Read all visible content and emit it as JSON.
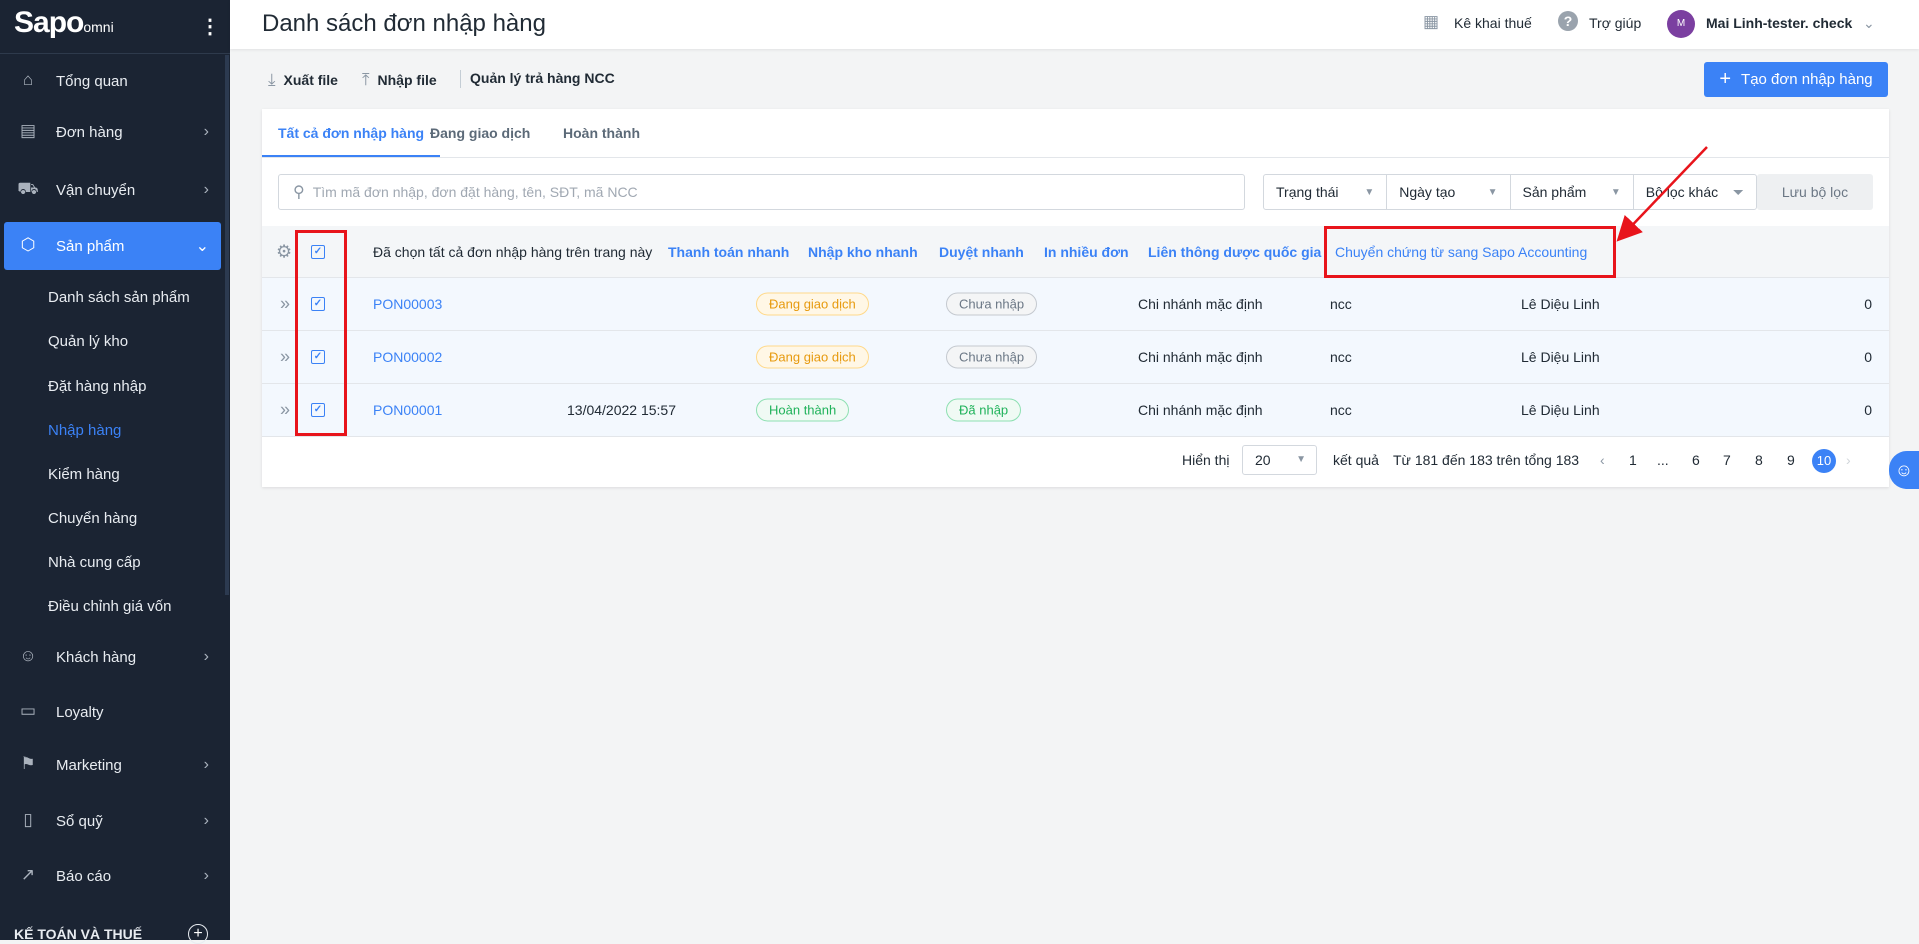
{
  "sidebar": {
    "logo": "Sapo",
    "logo_suffix": "omni",
    "items": [
      {
        "label": "Tổng quan",
        "icon": "home-icon"
      },
      {
        "label": "Đơn hàng",
        "icon": "clipboard-icon"
      },
      {
        "label": "Vận chuyển",
        "icon": "truck-icon"
      },
      {
        "label": "Sản phẩm",
        "icon": "box-icon"
      },
      {
        "label": "Khách hàng",
        "icon": "user-icon"
      },
      {
        "label": "Loyalty",
        "icon": "card-icon"
      },
      {
        "label": "Marketing",
        "icon": "flag-icon"
      },
      {
        "label": "Sổ quỹ",
        "icon": "cashbook-icon"
      },
      {
        "label": "Báo cáo",
        "icon": "chart-icon"
      }
    ],
    "sub_items": [
      "Danh sách sản phẩm",
      "Quản lý kho",
      "Đặt hàng nhập",
      "Nhập hàng",
      "Kiểm hàng",
      "Chuyển hàng",
      "Nhà cung cấp",
      "Điều chỉnh giá vốn"
    ],
    "section": "KẾ TOÁN VÀ THUẾ"
  },
  "header": {
    "title": "Danh sách đơn nhập hàng",
    "tax": "Kê khai thuế",
    "help": "Trợ giúp",
    "avatar": "M",
    "user": "Mai Linh-tester. check"
  },
  "toolbar": {
    "export": "Xuất file",
    "import": "Nhập file",
    "returns": "Quản lý trả hàng NCC",
    "create": "Tạo đơn nhập hàng"
  },
  "tabs": [
    "Tất cả đơn nhập hàng",
    "Đang giao dịch",
    "Hoàn thành"
  ],
  "search": {
    "placeholder": "Tìm mã đơn nhập, đơn đặt hàng, tên, SĐT, mã NCC"
  },
  "filters": [
    "Trạng thái",
    "Ngày tạo",
    "Sản phẩm",
    "Bộ lọc khác"
  ],
  "save_filter": "Lưu bộ lọc",
  "bulk": {
    "selected_text": "Đã chọn tất cả đơn nhập hàng trên trang này",
    "actions": [
      "Thanh toán nhanh",
      "Nhập kho nhanh",
      "Duyệt nhanh",
      "In nhiều đơn",
      "Liên thông dược quốc gia",
      "Chuyển chứng từ sang Sapo Accounting"
    ]
  },
  "rows": [
    {
      "code": "PON00003",
      "date": "",
      "status": "Đang giao dịch",
      "import": "Chưa nhập",
      "branch": "Chi nhánh mặc định",
      "supplier": "ncc",
      "staff": "Lê Diệu Linh",
      "amount": "0"
    },
    {
      "code": "PON00002",
      "date": "",
      "status": "Đang giao dịch",
      "import": "Chưa nhập",
      "branch": "Chi nhánh mặc định",
      "supplier": "ncc",
      "staff": "Lê Diệu Linh",
      "amount": "0"
    },
    {
      "code": "PON00001",
      "date": "13/04/2022 15:57",
      "status": "Hoàn thành",
      "import": "Đã nhập",
      "branch": "Chi nhánh mặc định",
      "supplier": "ncc",
      "staff": "Lê Diệu Linh",
      "amount": "0"
    }
  ],
  "pagination": {
    "show": "Hiển thị",
    "per_page": "20",
    "results": "kết quả",
    "range": "Từ 181 đến 183 trên tổng 183",
    "pages": [
      "1",
      "...",
      "6",
      "7",
      "8",
      "9",
      "10"
    ],
    "current": "10"
  },
  "colors": {
    "accent": "#3b82f6",
    "sidebar": "#1b2433",
    "annotation": "#e8141b"
  }
}
